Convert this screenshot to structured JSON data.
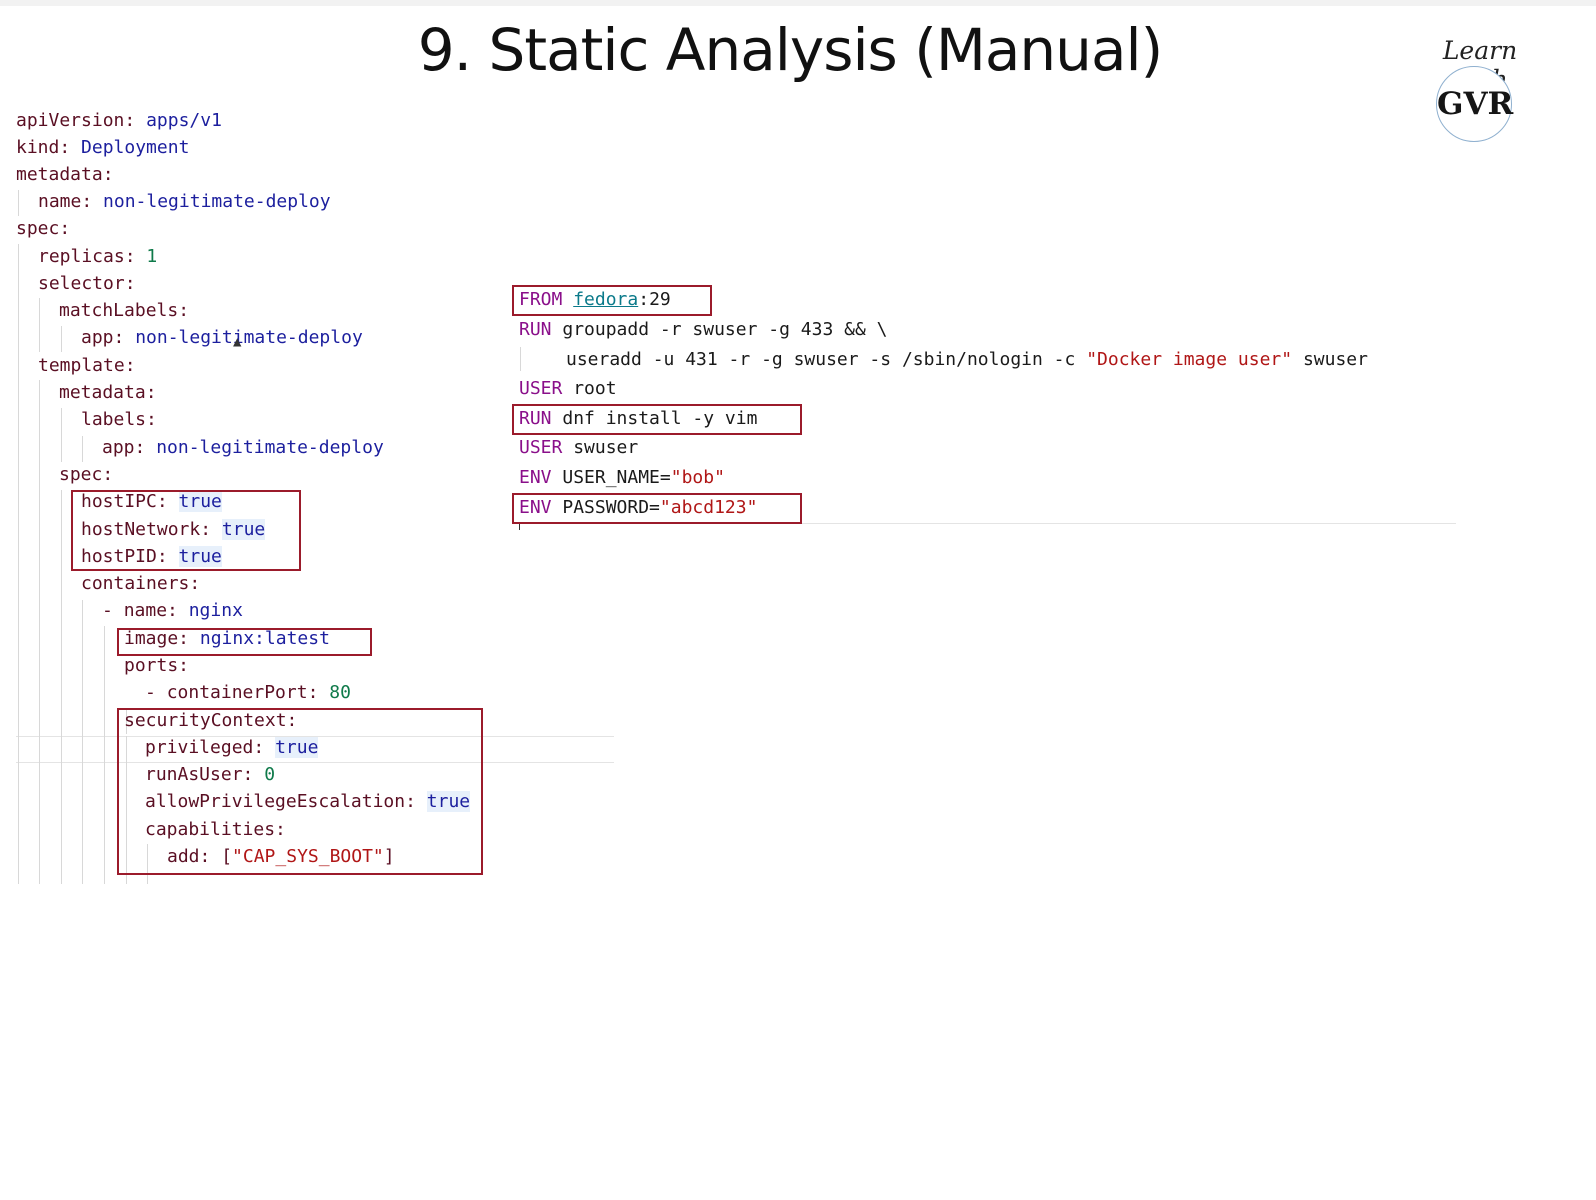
{
  "slide": {
    "title": "9. Static Analysis (Manual)",
    "brand": {
      "line1": "Learn with",
      "logo_text": "GVR"
    }
  },
  "yaml": {
    "apiVersion_key": "apiVersion:",
    "apiVersion_val": "apps/v1",
    "kind_key": "kind:",
    "kind_val": "Deployment",
    "metadata_key": "metadata:",
    "name_key": "name:",
    "name_val": "non-legitimate-deploy",
    "spec_key": "spec:",
    "replicas_key": "replicas:",
    "replicas_val": "1",
    "selector_key": "selector:",
    "matchLabels_key": "matchLabels:",
    "app_key": "app:",
    "app_val": "non-legitimate-deploy",
    "template_key": "template:",
    "t_metadata_key": "metadata:",
    "labels_key": "labels:",
    "labels_app_key": "app:",
    "labels_app_val": "non-legitimate-deploy",
    "t_spec_key": "spec:",
    "hostIPC_key": "hostIPC:",
    "hostIPC_val": "true",
    "hostNetwork_key": "hostNetwork:",
    "hostNetwork_val": "true",
    "hostPID_key": "hostPID:",
    "hostPID_val": "true",
    "containers_key": "containers:",
    "container_dash": "-",
    "container_name_key": "name:",
    "container_name_val": "nginx",
    "image_key": "image:",
    "image_val": "nginx:latest",
    "ports_key": "ports:",
    "port_dash": "-",
    "containerPort_key": "containerPort:",
    "containerPort_val": "80",
    "securityContext_key": "securityContext:",
    "privileged_key": "privileged:",
    "privileged_val": "true",
    "runAsUser_key": "runAsUser:",
    "runAsUser_val": "0",
    "allowPriv_key": "allowPrivilegeEscalation:",
    "allowPriv_val": "true",
    "capabilities_key": "capabilities:",
    "add_key": "add:",
    "add_open": "[",
    "add_val": "\"CAP_SYS_BOOT\"",
    "add_close": "]"
  },
  "dockerfile": {
    "from_kw": "FROM",
    "from_image": "fedora",
    "from_tag": ":29",
    "run1_kw": "RUN",
    "run1_text": "groupadd -r swuser -g 433 && \\",
    "run1_cont": "useradd -u 431 -r -g swuser -s /sbin/nologin -c",
    "run1_comment": "\"Docker image user\"",
    "run1_user": "swuser",
    "user1_kw": "USER",
    "user1_text": "root",
    "run2_kw": "RUN",
    "run2_text": "dnf install -y vim",
    "user2_kw": "USER",
    "user2_text": "swuser",
    "env1_kw": "ENV",
    "env1_key": "USER_NAME=",
    "env1_val": "\"bob\"",
    "env2_kw": "ENV",
    "env2_key": "PASSWORD=",
    "env2_val": "\"abcd123\""
  },
  "colors": {
    "highlight_box": "#9b1b2b",
    "yaml_key": "#5a0f23",
    "yaml_value": "#1c1f9e",
    "number": "#0f7a4a",
    "string": "#b01616",
    "docker_keyword": "#8a0f8a"
  }
}
